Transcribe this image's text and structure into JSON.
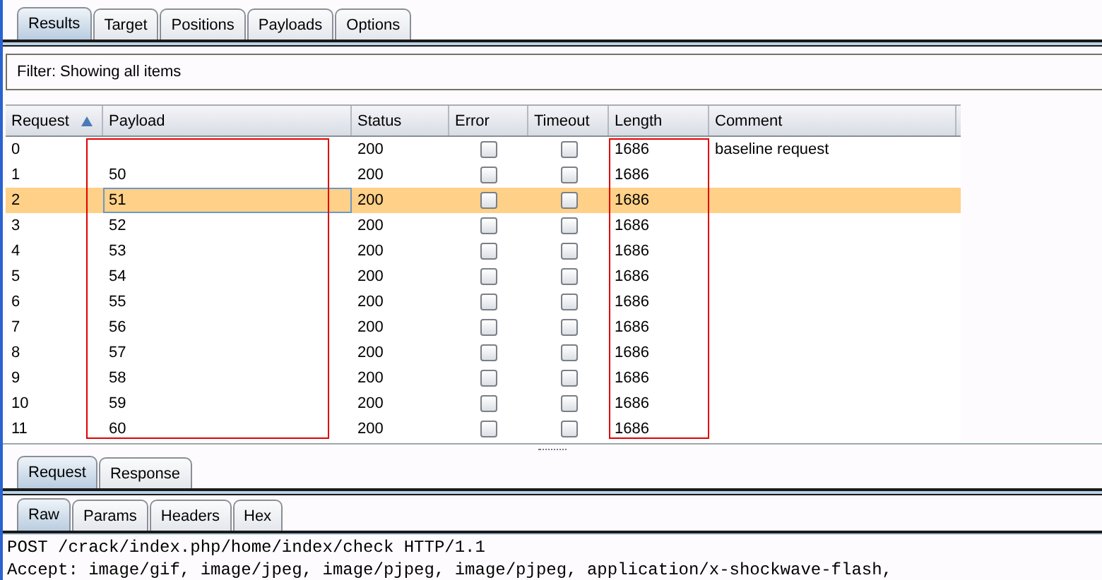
{
  "top_tabs": [
    {
      "label": "Results",
      "selected": true
    },
    {
      "label": "Target",
      "selected": false
    },
    {
      "label": "Positions",
      "selected": false
    },
    {
      "label": "Payloads",
      "selected": false
    },
    {
      "label": "Options",
      "selected": false
    }
  ],
  "filter": {
    "text": "Filter:  Showing all items"
  },
  "table": {
    "columns": [
      {
        "label": "Request",
        "sorted": true
      },
      {
        "label": "Payload",
        "sorted": false,
        "outlined": true
      },
      {
        "label": "Status",
        "sorted": false
      },
      {
        "label": "Error",
        "sorted": false
      },
      {
        "label": "Timeout",
        "sorted": false
      },
      {
        "label": "Length",
        "sorted": false,
        "outlined": true
      },
      {
        "label": "Comment",
        "sorted": false
      }
    ],
    "rows": [
      {
        "request": "0",
        "payload": "",
        "status": "200",
        "error": false,
        "timeout": false,
        "length": "1686",
        "comment": "baseline request",
        "selected": false
      },
      {
        "request": "1",
        "payload": "50",
        "status": "200",
        "error": false,
        "timeout": false,
        "length": "1686",
        "comment": "",
        "selected": false
      },
      {
        "request": "2",
        "payload": "51",
        "status": "200",
        "error": false,
        "timeout": false,
        "length": "1686",
        "comment": "",
        "selected": true
      },
      {
        "request": "3",
        "payload": "52",
        "status": "200",
        "error": false,
        "timeout": false,
        "length": "1686",
        "comment": "",
        "selected": false
      },
      {
        "request": "4",
        "payload": "53",
        "status": "200",
        "error": false,
        "timeout": false,
        "length": "1686",
        "comment": "",
        "selected": false
      },
      {
        "request": "5",
        "payload": "54",
        "status": "200",
        "error": false,
        "timeout": false,
        "length": "1686",
        "comment": "",
        "selected": false
      },
      {
        "request": "6",
        "payload": "55",
        "status": "200",
        "error": false,
        "timeout": false,
        "length": "1686",
        "comment": "",
        "selected": false
      },
      {
        "request": "7",
        "payload": "56",
        "status": "200",
        "error": false,
        "timeout": false,
        "length": "1686",
        "comment": "",
        "selected": false
      },
      {
        "request": "8",
        "payload": "57",
        "status": "200",
        "error": false,
        "timeout": false,
        "length": "1686",
        "comment": "",
        "selected": false
      },
      {
        "request": "9",
        "payload": "58",
        "status": "200",
        "error": false,
        "timeout": false,
        "length": "1686",
        "comment": "",
        "selected": false
      },
      {
        "request": "10",
        "payload": "59",
        "status": "200",
        "error": false,
        "timeout": false,
        "length": "1686",
        "comment": "",
        "selected": false
      },
      {
        "request": "11",
        "payload": "60",
        "status": "200",
        "error": false,
        "timeout": false,
        "length": "1686",
        "comment": "",
        "selected": false
      }
    ]
  },
  "detail_tabs": [
    {
      "label": "Request",
      "selected": true
    },
    {
      "label": "Response",
      "selected": false
    }
  ],
  "view_tabs": [
    {
      "label": "Raw",
      "selected": true
    },
    {
      "label": "Params",
      "selected": false
    },
    {
      "label": "Headers",
      "selected": false
    },
    {
      "label": "Hex",
      "selected": false
    }
  ],
  "raw_lines": [
    "POST /crack/index.php/home/index/check HTTP/1.1",
    "Accept: image/gif, image/jpeg, image/pjpeg, image/pjpeg, application/x-shockwave-flash,"
  ]
}
